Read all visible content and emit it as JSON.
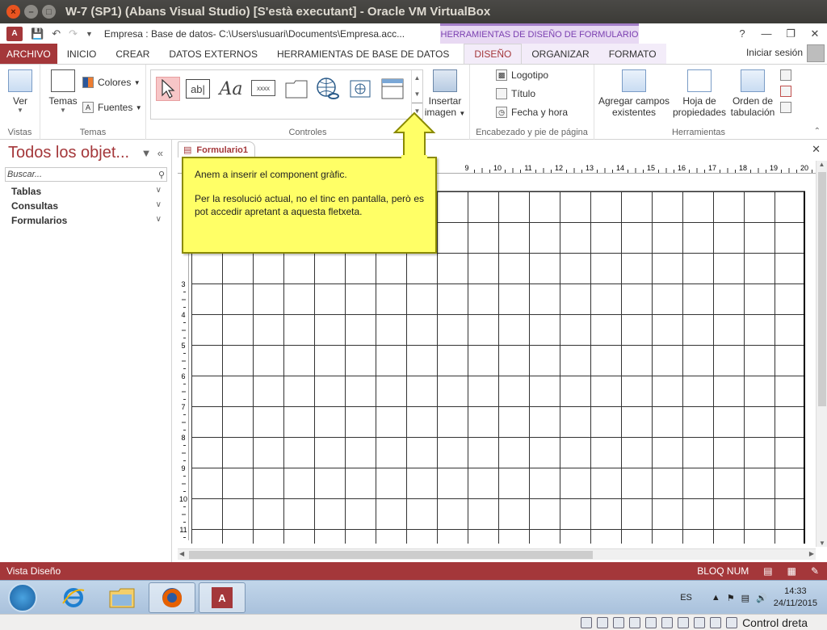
{
  "vbox": {
    "title": "W-7 (SP1) (Abans Visual Studio) [S'està executant] - Oracle VM VirtualBox",
    "host_key": "Control dreta"
  },
  "access": {
    "doc_title": "Empresa : Base de datos- C:\\Users\\usuari\\Documents\\Empresa.acc...",
    "context_header": "HERRAMIENTAS DE DISEÑO DE FORMULARIO",
    "signin": "Iniciar sesión",
    "tabs": [
      "ARCHIVO",
      "INICIO",
      "CREAR",
      "DATOS EXTERNOS",
      "HERRAMIENTAS DE BASE DE DATOS",
      "DISEÑO",
      "ORGANIZAR",
      "FORMATO"
    ],
    "active_tab": "DISEÑO",
    "ribbon": {
      "vistas": {
        "label": "Vistas",
        "ver": "Ver"
      },
      "temas": {
        "label": "Temas",
        "temas": "Temas",
        "colores": "Colores",
        "fuentes": "Fuentes"
      },
      "controles": {
        "label": "Controles",
        "textbox": "ab|",
        "label_ctrl": "Aa",
        "button": "xxxx"
      },
      "insertar_imagen": [
        "Insertar",
        "imagen"
      ],
      "encabezado": {
        "label": "Encabezado y pie de página",
        "logotipo": "Logotipo",
        "titulo": "Título",
        "fecha": "Fecha y hora"
      },
      "herramientas": {
        "label": "Herramientas",
        "agregar": [
          "Agregar campos",
          "existentes"
        ],
        "hoja": [
          "Hoja de",
          "propiedades"
        ],
        "orden": [
          "Orden de",
          "tabulación"
        ]
      }
    },
    "nav": {
      "title": "Todos los objet...",
      "search_placeholder": "Buscar...",
      "groups": [
        "Tablas",
        "Consultas",
        "Formularios"
      ]
    },
    "document": {
      "tab": "Formulario1"
    },
    "ruler_top": [
      "9",
      "10",
      "11",
      "12",
      "13",
      "14",
      "15",
      "16",
      "17",
      "18",
      "19",
      "20"
    ],
    "ruler_left": [
      "3",
      "4",
      "5",
      "6",
      "7",
      "8",
      "9",
      "10",
      "11"
    ],
    "status": {
      "left": "Vista Diseño",
      "numlock": "BLOQ NUM"
    }
  },
  "callout": {
    "line1": "Anem a inserir el component gràfic.",
    "line2": "Per la resolució actual, no el tinc en pantalla, però es pot accedir apretant a aquesta fletxeta."
  },
  "taskbar": {
    "lang": "ES",
    "time": "14:33",
    "date": "24/11/2015"
  },
  "colors": {
    "access_red": "#a4373a",
    "callout_yellow": "#ffff66",
    "context_purple": "#7a3fb0"
  }
}
